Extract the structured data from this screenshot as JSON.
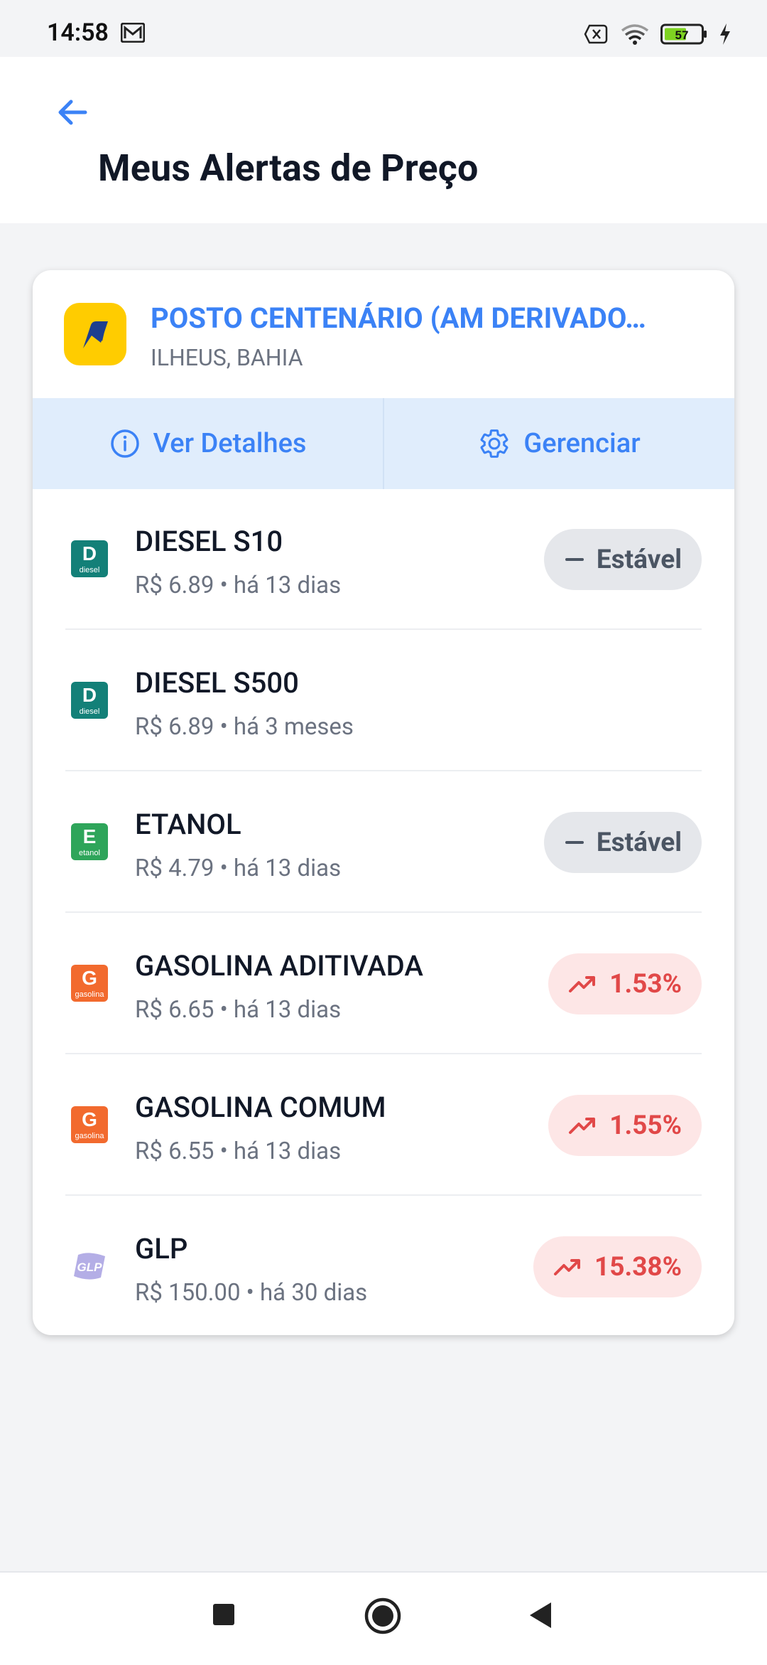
{
  "status_bar": {
    "time": "14:58",
    "battery": "57"
  },
  "header": {
    "title": "Meus Alertas de Preço"
  },
  "station": {
    "name": "POSTO CENTENÁRIO (AM DERIVADO…",
    "location": "ILHEUS, BAHIA"
  },
  "actions": {
    "details": "Ver Detalhes",
    "manage": "Gerenciar"
  },
  "fuels": [
    {
      "icon_letter": "D",
      "icon_sub": "diesel",
      "color": "#138078",
      "name": "DIESEL S10",
      "sub": "R$ 6.89 • há 13 dias",
      "trend": "Estável",
      "trend_type": "stable"
    },
    {
      "icon_letter": "D",
      "icon_sub": "diesel",
      "color": "#138078",
      "name": "DIESEL S500",
      "sub": "R$ 6.89 • há 3 meses",
      "trend": "",
      "trend_type": "none"
    },
    {
      "icon_letter": "E",
      "icon_sub": "etanol",
      "color": "#2ea55a",
      "name": "ETANOL",
      "sub": "R$ 4.79 • há 13 dias",
      "trend": "Estável",
      "trend_type": "stable"
    },
    {
      "icon_letter": "G",
      "icon_sub": "gasolina",
      "color": "#f26a2e",
      "name": "GASOLINA ADITIVADA",
      "sub": "R$ 6.65 • há 13 dias",
      "trend": "1.53%",
      "trend_type": "up"
    },
    {
      "icon_letter": "G",
      "icon_sub": "gasolina",
      "color": "#f26a2e",
      "name": "GASOLINA COMUM",
      "sub": "R$ 6.55 • há 13 dias",
      "trend": "1.55%",
      "trend_type": "up"
    },
    {
      "icon_letter": "GLP",
      "icon_sub": "",
      "color": "#b4aee6",
      "name": "GLP",
      "sub": "R$ 150.00 • há 30 dias",
      "trend": "15.38%",
      "trend_type": "up"
    }
  ],
  "colors": {
    "accent": "#3b82f6",
    "up": "#e14848",
    "stable": "#4b5563"
  },
  "icons": {
    "back": "arrow-left-icon",
    "details": "info-icon",
    "manage": "gear-icon",
    "stable": "minus-icon",
    "up": "trending-up-icon"
  }
}
